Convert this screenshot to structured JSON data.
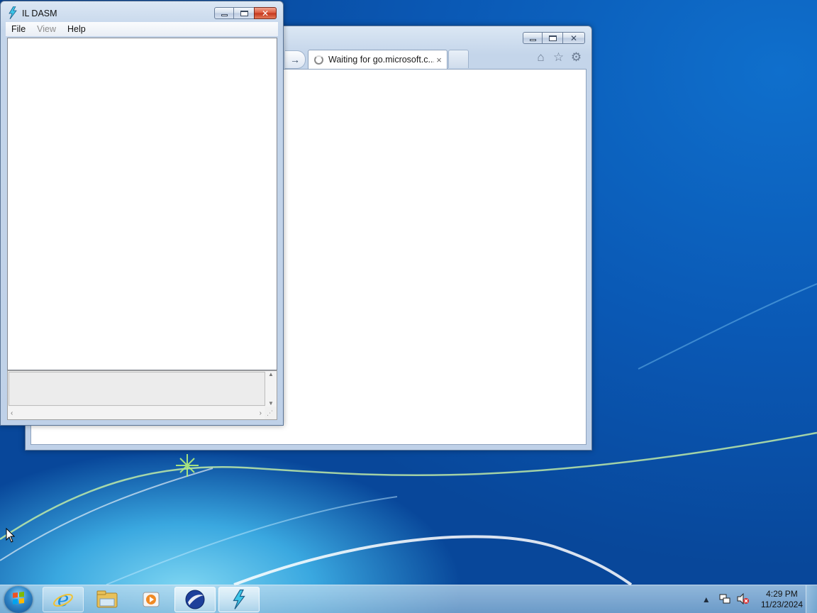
{
  "desktop": {
    "background_color": "#0b5cb8"
  },
  "browser": {
    "tab_title": "Waiting for go.microsoft.c...",
    "tab_close": "×",
    "forward_arrow": "→",
    "icons": [
      "home-icon",
      "favorites-star-icon",
      "tools-gear-icon"
    ]
  },
  "ildasm": {
    "title": "IL DASM",
    "menu": [
      {
        "label": "File",
        "enabled": true
      },
      {
        "label": "View",
        "enabled": false
      },
      {
        "label": "Help",
        "enabled": true
      }
    ]
  },
  "taskbar": {
    "buttons": [
      "start-button",
      "internet-explorer",
      "windows-explorer",
      "media-player",
      "net-reflector",
      "il-dasm"
    ],
    "clock_time": "4:29 PM",
    "clock_date": "11/23/2024",
    "tray_icons": [
      "show-hidden-icons",
      "network-icon",
      "volume-muted-icon"
    ]
  }
}
